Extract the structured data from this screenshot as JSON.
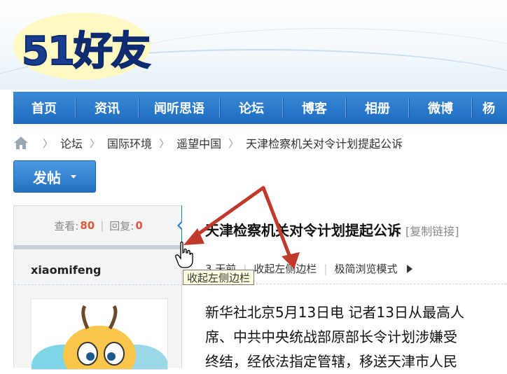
{
  "site": {
    "logo_text": "51好友"
  },
  "nav": {
    "items": [
      "首页",
      "资讯",
      "闻听思语",
      "论坛",
      "博客",
      "相册",
      "微博",
      "杨"
    ]
  },
  "breadcrumb": {
    "items": [
      "论坛",
      "国际环境",
      "遥望中国",
      "天津检察机关对令计划提起公诉"
    ]
  },
  "post_button": {
    "label": "发帖"
  },
  "stats": {
    "views_label": "查看:",
    "views": "80",
    "replies_label": "回复:",
    "replies": "0"
  },
  "author": {
    "name": "xiaomifeng"
  },
  "thread": {
    "title": "天津检察机关对令计划提起公诉",
    "copy_link": "[复制链接]",
    "meta_time": "3 天前",
    "collapse_sidebar": "收起左侧边栏",
    "simple_mode": "极简浏览模式"
  },
  "content": {
    "lines": [
      "新华社北京5月13日电  记者13日从最高人",
      "席、中共中央统战部原部长令计划涉嫌受",
      "终结，经依法指定管辖，移送天津市人民"
    ]
  },
  "tooltip": {
    "text": "收起左侧边栏"
  },
  "colors": {
    "nav_blue": "#1e6cc0",
    "accent_red": "#e2563a",
    "arrow_red": "#c0392b"
  }
}
